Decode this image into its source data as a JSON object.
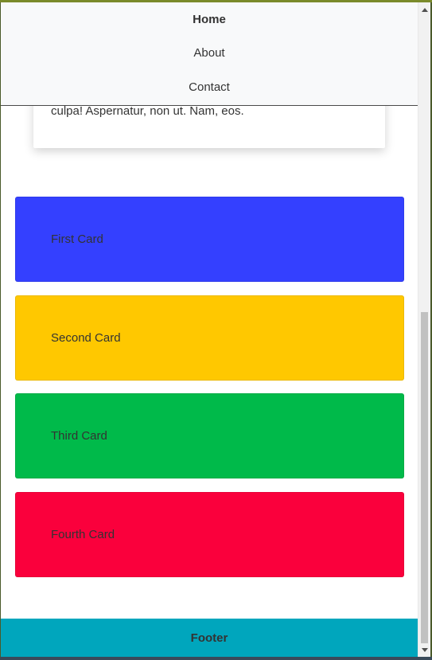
{
  "navbar": {
    "items": [
      {
        "label": "Home",
        "active": true
      },
      {
        "label": "About",
        "active": false
      },
      {
        "label": "Contact",
        "active": false
      }
    ]
  },
  "article": {
    "text_line": "culpa! Aspernatur, non ut. Nam, eos."
  },
  "cards": [
    {
      "label": "First Card",
      "color": "#3440ff"
    },
    {
      "label": "Second Card",
      "color": "#ffc800"
    },
    {
      "label": "Third Card",
      "color": "#00ba4a"
    },
    {
      "label": "Fourth Card",
      "color": "#fa003c"
    }
  ],
  "footer": {
    "label": "Footer",
    "color": "#00a6bd"
  },
  "scrollbar": {
    "position_fraction": 0.5
  }
}
